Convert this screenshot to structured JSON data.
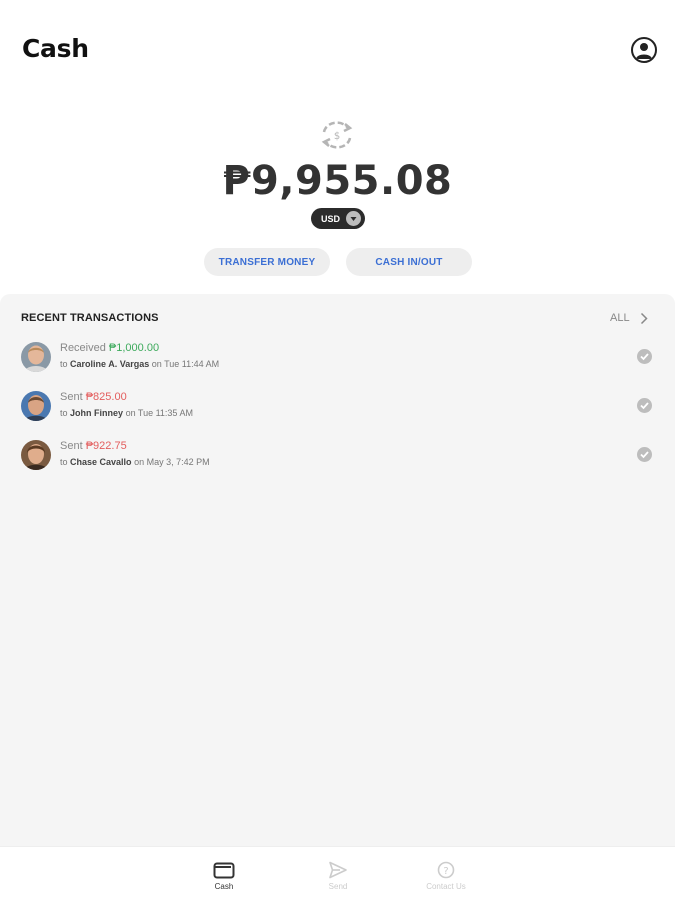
{
  "header": {
    "title": "Cash",
    "profile_icon": "account-circle-icon"
  },
  "balance": {
    "amount": "₱9,955.08",
    "currency": "USD",
    "exchange_icon": "currency-exchange-icon"
  },
  "actions": {
    "transfer_label": "TRANSFER MONEY",
    "cashinout_label": "CASH IN/OUT"
  },
  "transactions": {
    "title": "RECENT TRANSACTIONS",
    "all_label": "ALL",
    "items": [
      {
        "type": "Received",
        "amount": "₱1,000.00",
        "prefix": "to",
        "name": "Caroline A. Vargas",
        "when": "on Tue 11:44 AM",
        "direction": "in"
      },
      {
        "type": "Sent",
        "amount": "₱825.00",
        "prefix": "to",
        "name": "John Finney",
        "when": "on Tue 11:35 AM",
        "direction": "out"
      },
      {
        "type": "Sent",
        "amount": "₱922.75",
        "prefix": "to",
        "name": "Chase Cavallo",
        "when": "on May 3, 7:42 PM",
        "direction": "out"
      }
    ]
  },
  "nav": {
    "cash": "Cash",
    "send": "Send",
    "contact": "Contact Us"
  },
  "colors": {
    "accent": "#3b6fd4",
    "received": "#3daa5c",
    "sent": "#e35d5d",
    "panel": "#f5f5f5"
  }
}
